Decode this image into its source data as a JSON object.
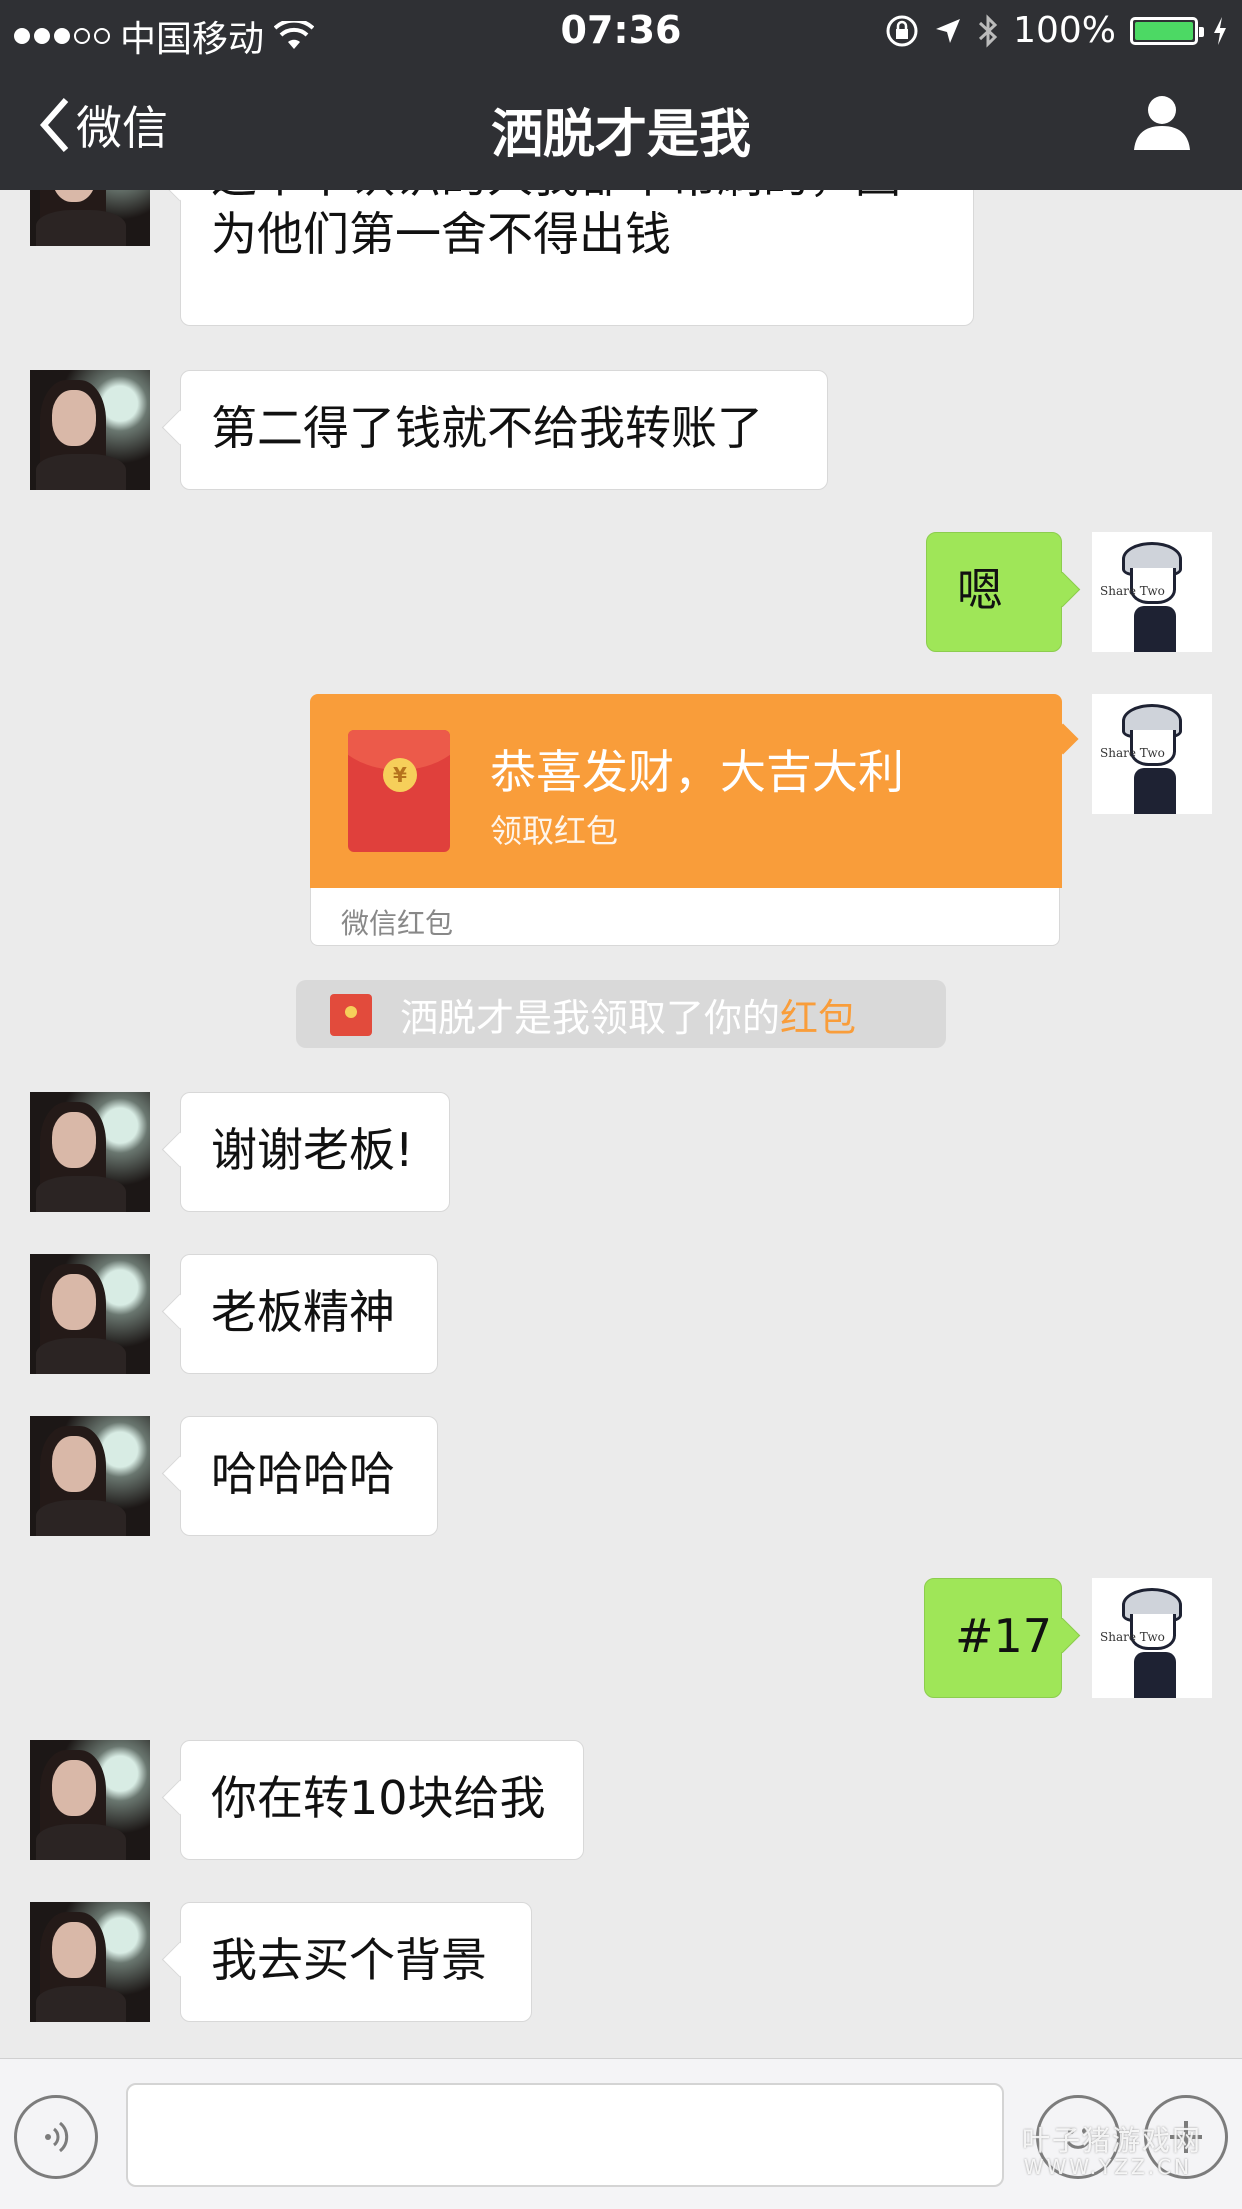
{
  "status_bar": {
    "carrier": "中国移动",
    "time": "07:36",
    "battery_percent": "100%",
    "battery_level": 1.0,
    "icons": [
      "signal-dots-icon",
      "wifi-icon",
      "rotation-lock-icon",
      "location-icon",
      "bluetooth-icon",
      "battery-icon",
      "charging-icon"
    ]
  },
  "nav": {
    "back_label": "微信",
    "title": "洒脱才是我",
    "contact_icon": "person-icon"
  },
  "messages": [
    {
      "side": "left",
      "text": "这个不认识的人我都不帮刷的，因为他们第一舍不得出钱"
    },
    {
      "side": "left",
      "text": "第二得了钱就不给我转账了"
    },
    {
      "side": "right",
      "text": "嗯"
    },
    {
      "side": "right",
      "type": "red_packet",
      "title": "恭喜发财，大吉大利",
      "subtitle": "领取红包",
      "footer": "微信红包"
    },
    {
      "side": "system",
      "text": "洒脱才是我领取了你的",
      "link": "红包"
    },
    {
      "side": "left",
      "text": "谢谢老板!"
    },
    {
      "side": "left",
      "text": "老板精神"
    },
    {
      "side": "left",
      "text": "哈哈哈哈"
    },
    {
      "side": "right",
      "text": "#17"
    },
    {
      "side": "left",
      "text": "你在转10块给我"
    },
    {
      "side": "left",
      "text": "我去买个背景"
    }
  ],
  "avatar_caption": "Share Two",
  "input_bar": {
    "placeholder": "",
    "icons": [
      "voice-icon",
      "emoji-icon",
      "plus-icon"
    ]
  },
  "watermark": {
    "line1": "叶子猪游戏网",
    "line2": "WWW.YZZ.CN"
  },
  "colors": {
    "navbar_bg": "#2f3034",
    "chat_bg": "#ebebeb",
    "sent_bubble": "#9fe658",
    "red_packet": "#f99d3a",
    "battery_green": "#4cd964"
  }
}
